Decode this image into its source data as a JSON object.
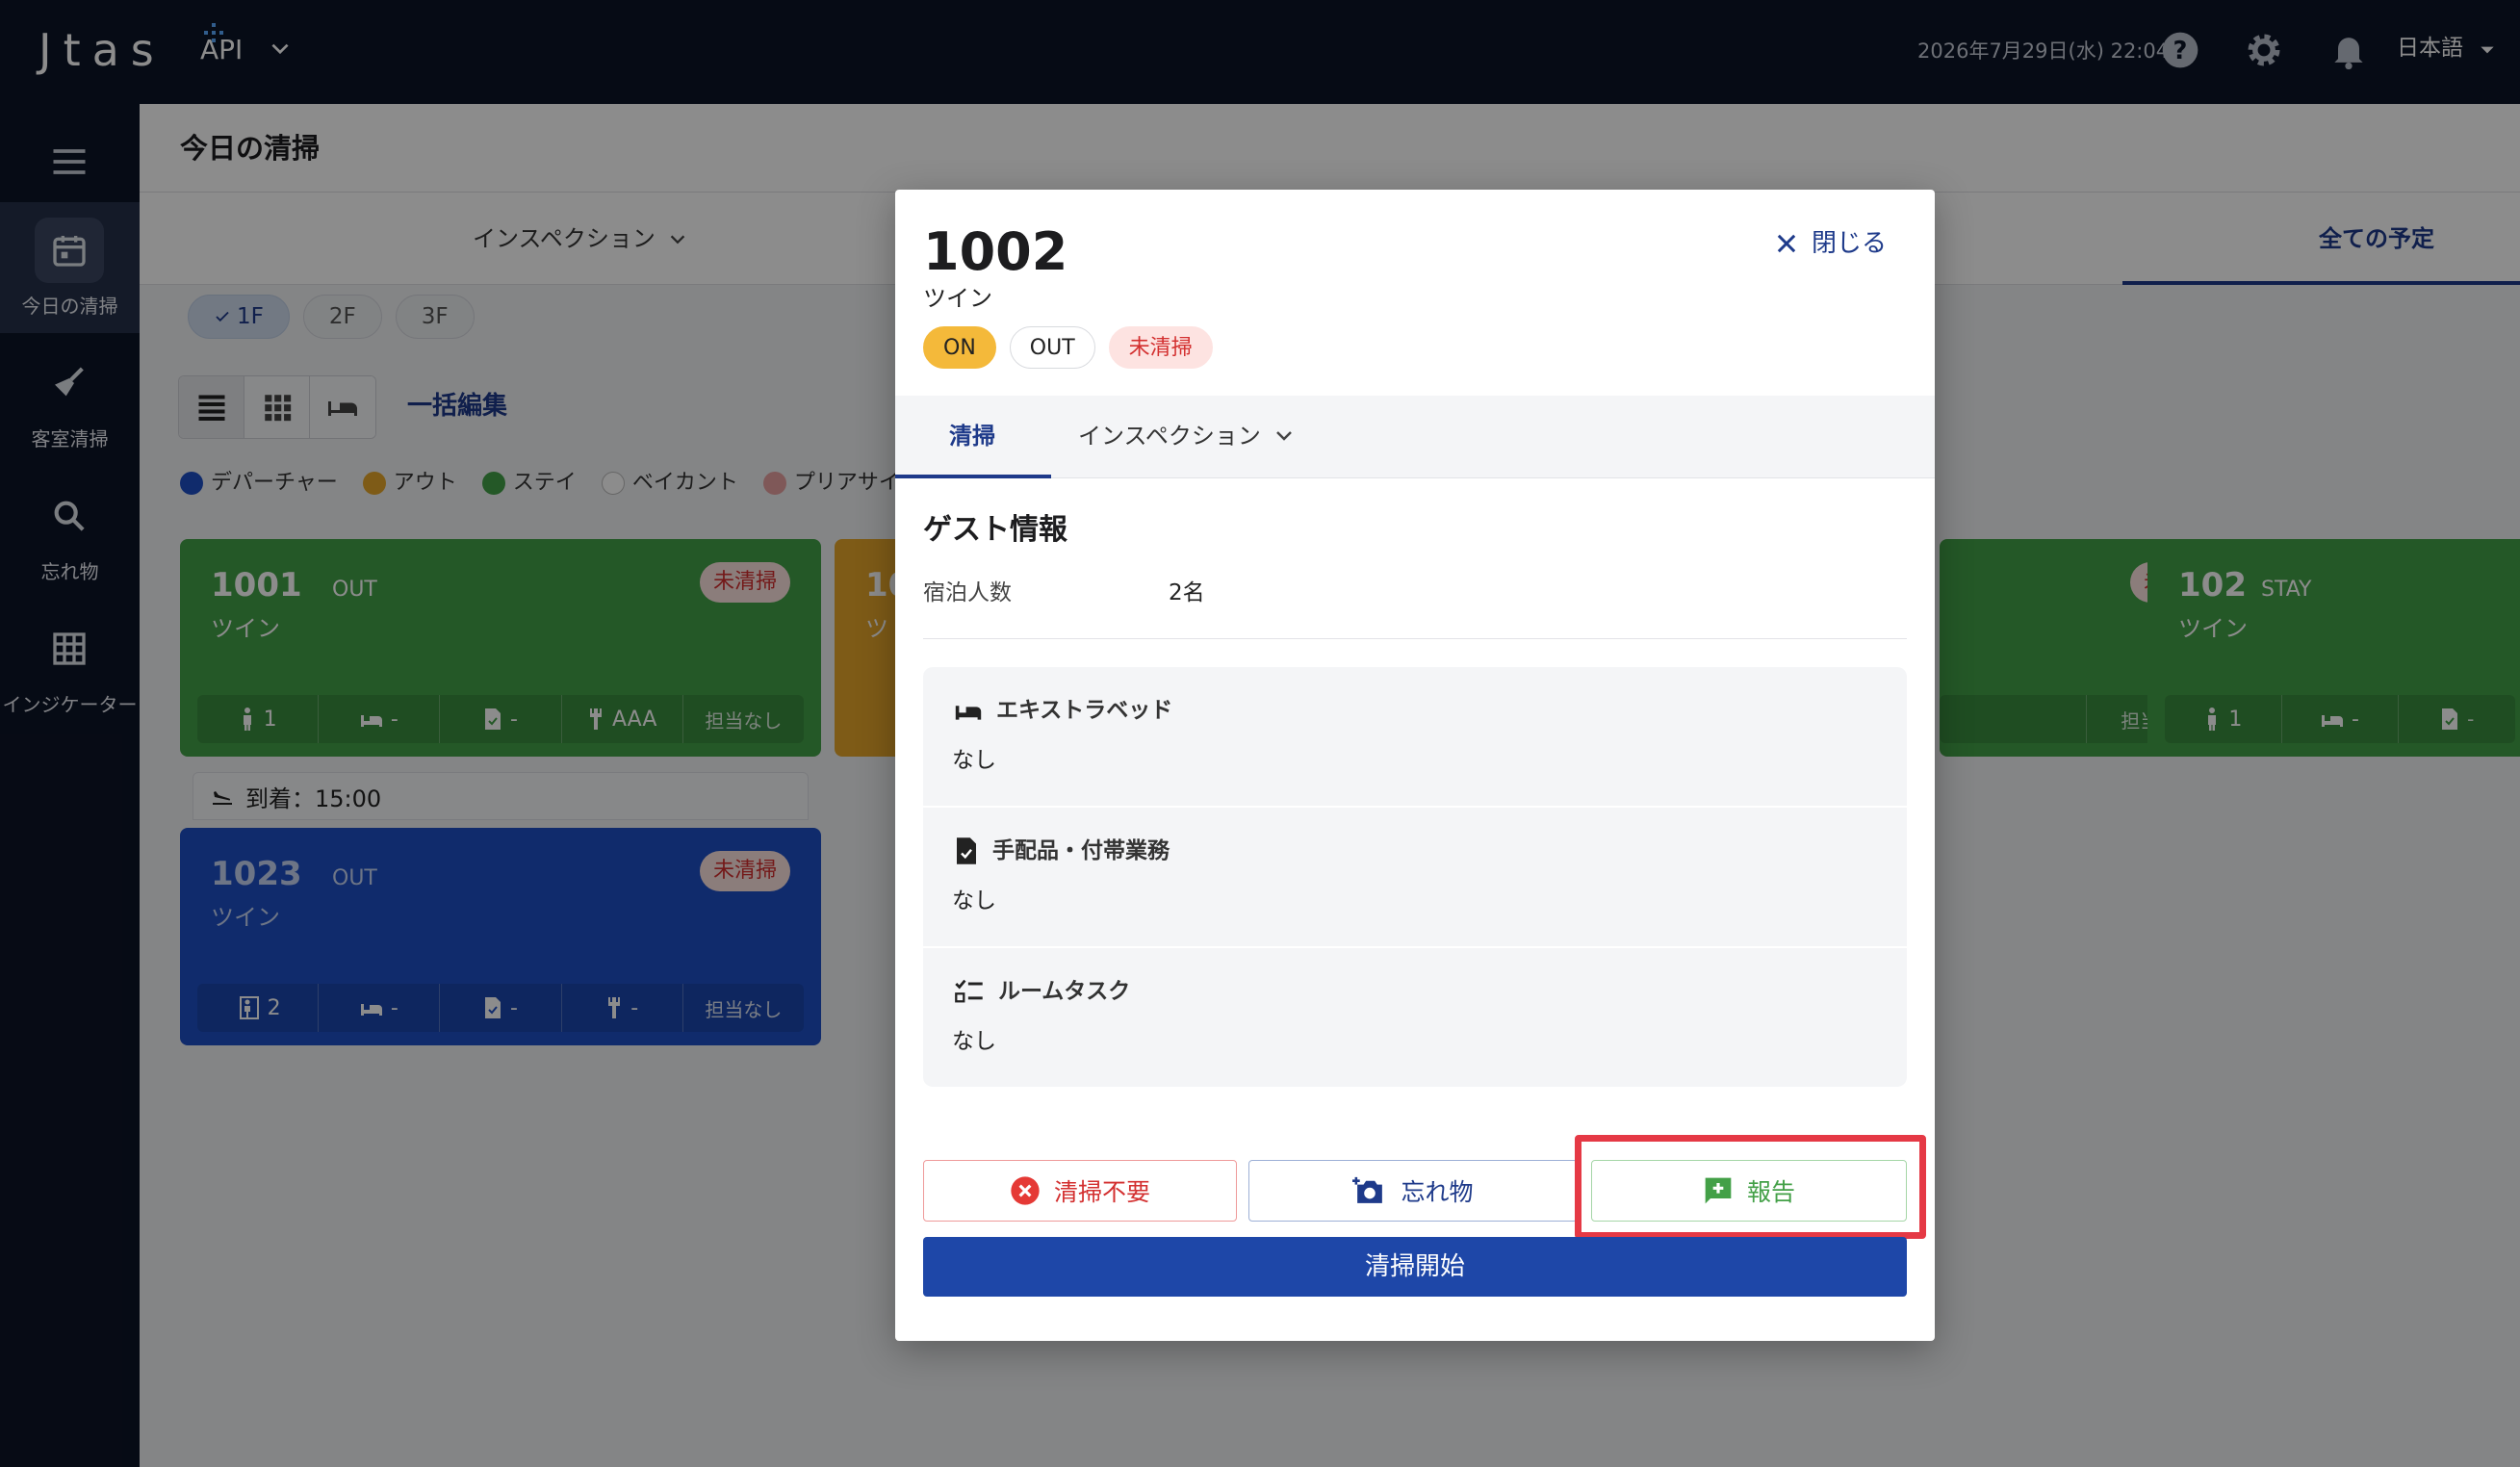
{
  "header": {
    "logo": "Jtas",
    "product": "API",
    "datetime": "2026年7月29日(水) 22:04",
    "language": "日本語",
    "icons": [
      "help-icon",
      "gear-icon",
      "bell-icon",
      "chevron-down-icon"
    ]
  },
  "sidebar": {
    "items": [
      {
        "label": "今日の清掃",
        "icon": "calendar-icon"
      },
      {
        "label": "客室清掃",
        "icon": "broom-icon"
      },
      {
        "label": "忘れ物",
        "icon": "search-icon"
      },
      {
        "label": "インジケーター",
        "icon": "grid-icon"
      }
    ]
  },
  "main": {
    "title": "今日の清掃",
    "tab_inspection": "インスペクション",
    "tab_all": "全ての予定",
    "floors": [
      "1F",
      "2F",
      "3F"
    ],
    "bulk_edit": "一括編集",
    "legend": [
      {
        "label": "デパーチャー",
        "color": "#1e4fc5"
      },
      {
        "label": "アウト",
        "color": "#e6a72a"
      },
      {
        "label": "ステイ",
        "color": "#43a047"
      },
      {
        "label": "ベイカント",
        "color": "#ffffff"
      },
      {
        "label": "プリアサイ",
        "color": "#e8a0a0"
      }
    ],
    "cards": [
      {
        "number": "1001",
        "status": "OUT",
        "type": "ツイン",
        "badge": "未清掃",
        "guests": "1",
        "bed": "-",
        "doc": "-",
        "note": "AAA",
        "staff": "担当なし"
      },
      {
        "number": "10",
        "status": "",
        "type": "ツ",
        "badge": "",
        "guests": "",
        "bed": "",
        "doc": "",
        "note": "",
        "staff": ""
      },
      {
        "number": "",
        "status": "",
        "type": "",
        "badge": "未清掃",
        "guests": "",
        "bed": "",
        "doc": "",
        "note": "",
        "staff": "担当なし"
      },
      {
        "number": "102",
        "status": "STAY",
        "type": "ツイン",
        "badge": "",
        "guests": "1",
        "bed": "-",
        "doc": "-",
        "note": "",
        "staff": ""
      },
      {
        "number": "1023",
        "status": "OUT",
        "type": "ツイン",
        "badge": "未清掃",
        "guests": "2",
        "bed": "-",
        "doc": "-",
        "note": "-",
        "staff": "担当なし"
      }
    ],
    "arrival": "到着：15:00"
  },
  "modal": {
    "room_number": "1002",
    "room_type": "ツイン",
    "close_label": "閉じる",
    "chips": [
      "ON",
      "OUT",
      "未清掃"
    ],
    "tab_clean": "清掃",
    "tab_inspection": "インスペクション",
    "guest_title": "ゲスト情報",
    "guest_label": "宿泊人数",
    "guest_value": "2名",
    "sections": [
      {
        "title": "エキストラベッド",
        "value": "なし",
        "icon": "bed-icon"
      },
      {
        "title": "手配品・付帯業務",
        "value": "なし",
        "icon": "document-check-icon"
      },
      {
        "title": "ルームタスク",
        "value": "なし",
        "icon": "checklist-icon"
      }
    ],
    "btn_no_cleaning": "清掃不要",
    "btn_lost_item": "忘れ物",
    "btn_report": "報告",
    "btn_start": "清掃開始",
    "colors": {
      "primary": "#1e3a8a",
      "danger": "#d32f2f",
      "success": "#43a047",
      "highlight": "#e53945"
    }
  }
}
